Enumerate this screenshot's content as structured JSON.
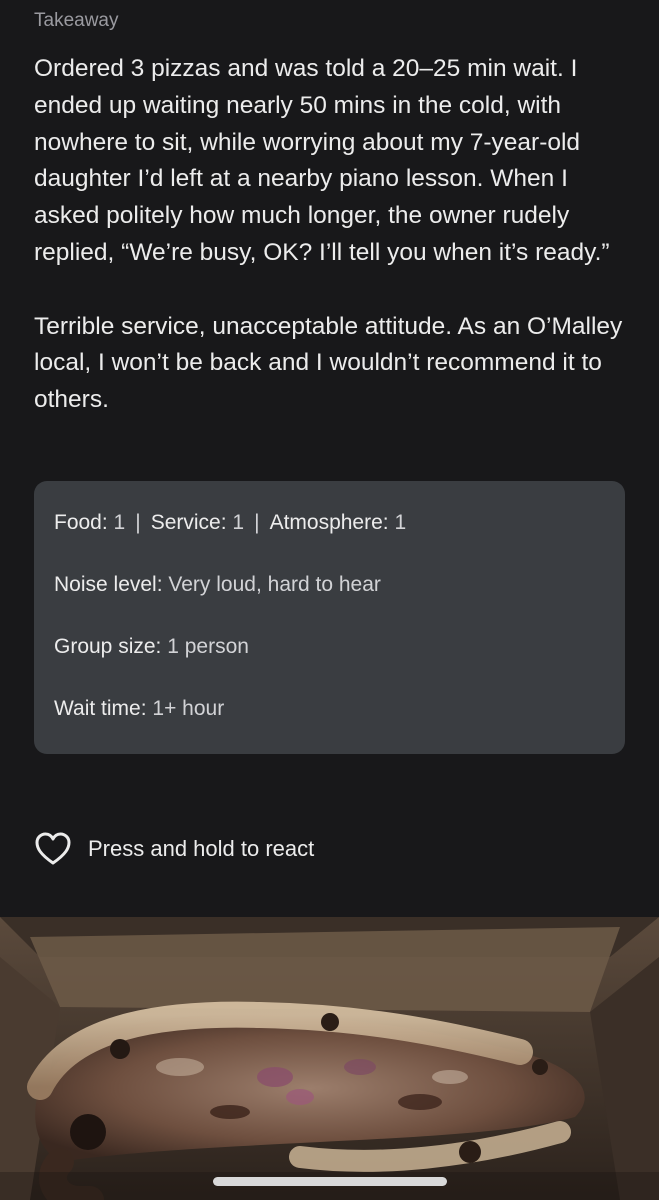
{
  "review": {
    "service_type": "Takeaway",
    "paragraphs": [
      "Ordered 3 pizzas and was told a 20–25 min wait. I ended up waiting nearly 50 mins in the cold, with nowhere to sit, while worrying about my 7-year-old daughter I’d left at a nearby piano lesson. When I asked politely how much longer, the owner rudely replied, “We’re busy, OK? I’ll tell you when it’s ready.”",
      "Terrible service, unacceptable attitude. As an O’Malley local, I won’t be back and I wouldn’t recommend it to others."
    ]
  },
  "details": {
    "food_label": "Food:",
    "food_value": "1",
    "service_label": "Service:",
    "service_value": "1",
    "atmosphere_label": "Atmosphere:",
    "atmosphere_value": "1",
    "separator": "|",
    "noise_label": "Noise level:",
    "noise_value": "Very loud, hard to hear",
    "group_label": "Group size:",
    "group_value": "1 person",
    "wait_label": "Wait time:",
    "wait_value": "1+ hour"
  },
  "reaction": {
    "icon": "heart-outline-icon",
    "label": "Press and hold to react"
  },
  "colors": {
    "background": "#18181a",
    "card": "#3a3d41",
    "text": "#ececec",
    "muted": "#9a9aa0"
  }
}
